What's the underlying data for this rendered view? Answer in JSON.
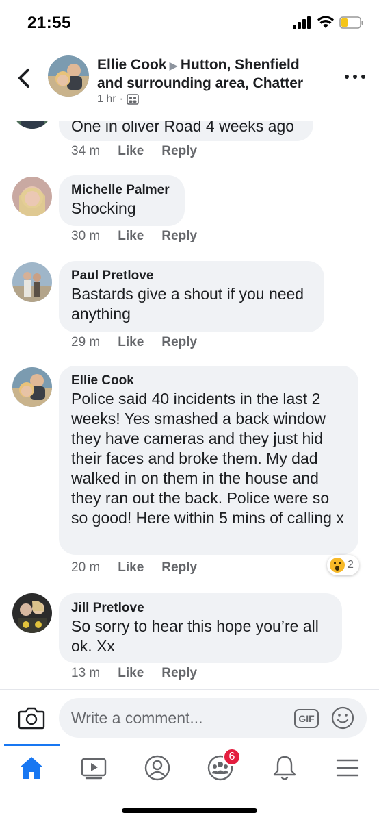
{
  "status_bar": {
    "time": "21:55"
  },
  "header": {
    "author": "Ellie Cook",
    "group": "Hutton, Shenfield and surrounding area, Chatter",
    "time": "1 hr",
    "separator": "·"
  },
  "comments": [
    {
      "name": "",
      "text": "One in oliver Road 4 weeks ago",
      "time": "34 m",
      "like": "Like",
      "reply": "Reply"
    },
    {
      "name": "Michelle Palmer",
      "text": "Shocking",
      "time": "30 m",
      "like": "Like",
      "reply": "Reply"
    },
    {
      "name": "Paul Pretlove",
      "text": "Bastards give a shout if you need anything",
      "time": "29 m",
      "like": "Like",
      "reply": "Reply"
    },
    {
      "name": "Ellie Cook",
      "text": "Police said 40 incidents in the last 2 weeks! Yes smashed a back window they have cameras and they just hid their faces and broke them. My dad walked in on them in the house and they ran out the back. Police were so so good! Here within 5 mins of calling x",
      "time": "20 m",
      "like": "Like",
      "reply": "Reply",
      "reaction_count": "2",
      "reaction_icon": "wow-reaction-icon"
    },
    {
      "name": "Jill Pretlove",
      "text": "So sorry to hear this hope you’re all ok. Xx",
      "time": "13 m",
      "like": "Like",
      "reply": "Reply"
    }
  ],
  "composer": {
    "placeholder": "Write a comment...",
    "gif_label": "GIF"
  },
  "bottom_nav": {
    "items": [
      "home-icon",
      "watch-icon",
      "profile-icon",
      "groups-icon",
      "notifications-icon",
      "menu-icon"
    ],
    "groups_badge": "6",
    "accent": "#1877f2"
  },
  "colors": {
    "bubble": "#f0f2f5",
    "secondary_text": "#65676b",
    "badge": "#e41e3f"
  }
}
